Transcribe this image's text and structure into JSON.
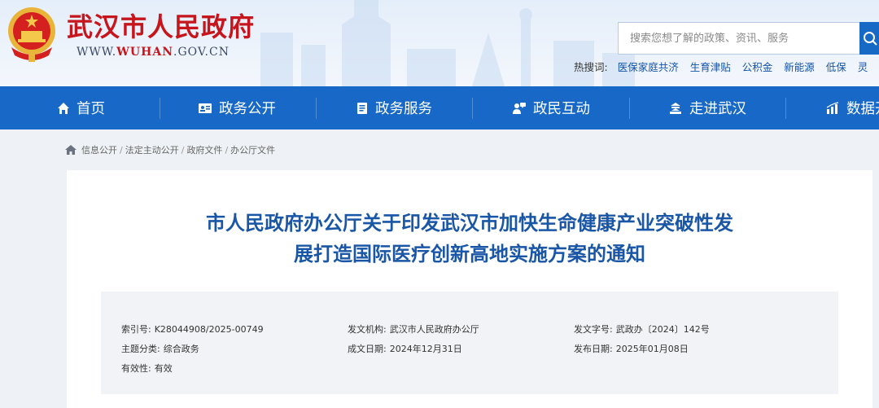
{
  "header": {
    "site_title": "武汉市人民政府",
    "domain_prefix": "WWW.",
    "domain_brand": "WUHAN",
    "domain_suffix": ".GOV.CN",
    "search_placeholder": "搜索您想了解的政策、资讯、服务",
    "hot_label": "热搜词:",
    "hot_words": [
      "医保家庭共济",
      "生育津贴",
      "公积金",
      "新能源",
      "低保",
      "灵"
    ]
  },
  "nav": {
    "items": [
      {
        "label": "首页",
        "icon": "home-icon"
      },
      {
        "label": "政务公开",
        "icon": "id-card-icon"
      },
      {
        "label": "政务服务",
        "icon": "document-icon"
      },
      {
        "label": "政民互动",
        "icon": "people-chat-icon"
      },
      {
        "label": "走进武汉",
        "icon": "landmark-icon"
      },
      {
        "label": "数据开",
        "icon": "bar-chart-icon"
      }
    ]
  },
  "breadcrumb": [
    "信息公开",
    "法定主动公开",
    "政府文件",
    "办公厅文件"
  ],
  "document": {
    "title_line1": "市人民政府办公厅关于印发武汉市加快生命健康产业突破性发",
    "title_line2": "展打造国际医疗创新高地实施方案的通知",
    "meta": {
      "index_label": "索引号:",
      "index_value": "K28044908/2025-00749",
      "issuer_label": "发文机构:",
      "issuer_value": "武汉市人民政府办公厅",
      "doc_no_label": "发文字号:",
      "doc_no_value": "武政办〔2024〕142号",
      "topic_label": "主题分类:",
      "topic_value": "综合政务",
      "created_label": "成文日期:",
      "created_value": "2024年12月31日",
      "published_label": "发布日期:",
      "published_value": "2025年01月08日",
      "validity_label": "有效性:",
      "validity_value": "有效"
    }
  },
  "colors": {
    "brand_red": "#c6151c",
    "nav_blue": "#1768c7",
    "title_blue": "#1a56a6",
    "link_blue": "#1453a8"
  }
}
